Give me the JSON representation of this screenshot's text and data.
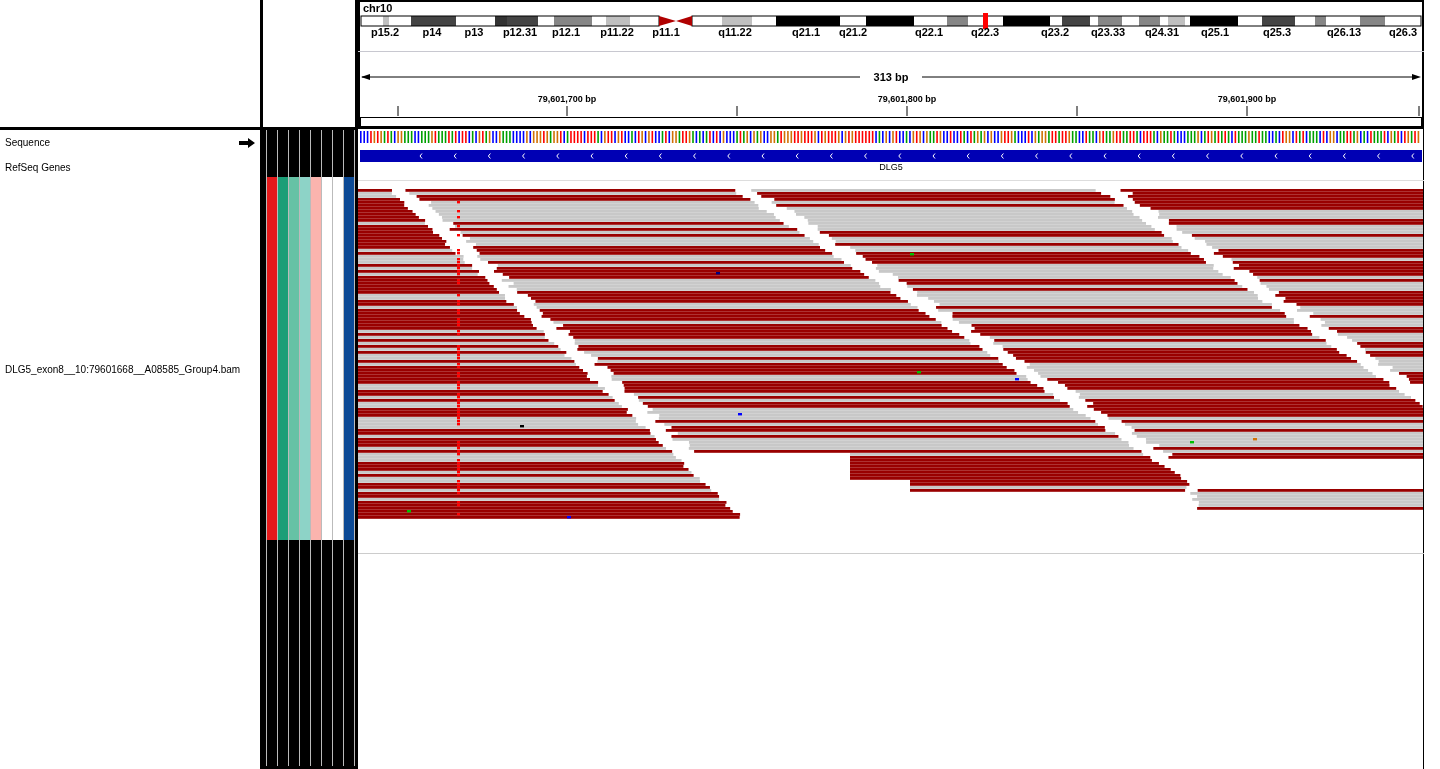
{
  "ideogram": {
    "chromosome": "chr10",
    "band_labels": [
      "p15.2",
      "p14",
      "p13",
      "p12.31",
      "p12.1",
      "p11.22",
      "p11.1",
      "q11.22",
      "q21.1",
      "q21.2",
      "q22.1",
      "q22.3",
      "q23.2",
      "q23.33",
      "q24.31",
      "q25.1",
      "q25.3",
      "q26.13",
      "q26.3"
    ]
  },
  "ruler": {
    "span": "313 bp",
    "tick_labels": [
      "79,601,700 bp",
      "79,601,800 bp",
      "79,601,900 bp"
    ]
  },
  "tracks": [
    {
      "kind": "sequence",
      "name": "Sequence"
    },
    {
      "kind": "gene",
      "name": "RefSeq Genes",
      "gene": "DLG5"
    },
    {
      "kind": "alignment",
      "name": "DLG5_exon8__10:79601668__A08585_Group4.bam"
    }
  ],
  "attribute_columns": [
    {
      "color": "#e41a1c"
    },
    {
      "color": "#1b9e77"
    },
    {
      "color": "#66c2a5"
    },
    {
      "color": "#8dd3c7"
    },
    {
      "color": "#fbb4ae"
    },
    {
      "color": "#ffffff"
    },
    {
      "color": "#ffffff"
    },
    {
      "color": "#0c4a96"
    }
  ]
}
